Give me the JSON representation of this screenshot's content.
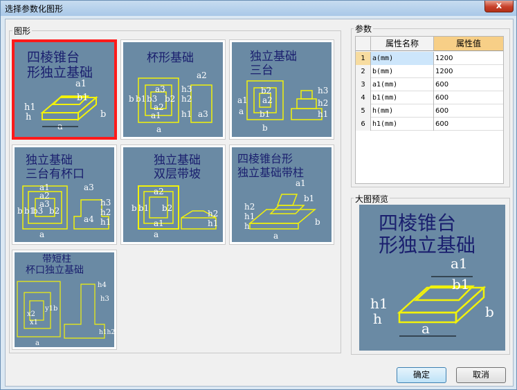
{
  "window": {
    "title": "选择参数化图形",
    "close_symbol": "x"
  },
  "shapes_group": {
    "label": "图形",
    "thumbnails": [
      {
        "lines": [
          "四棱锥台",
          "形独立基础"
        ],
        "dims": [
          "a1",
          "b1",
          "h1",
          "h",
          "a",
          "b"
        ]
      },
      {
        "lines": [
          "杯形基础"
        ],
        "dims": [
          "a2",
          "a3",
          "b",
          "b1",
          "b3",
          "b2",
          "a2",
          "a1",
          "h3",
          "h2",
          "h1",
          "a3",
          "a"
        ]
      },
      {
        "lines": [
          "独立基础",
          "三台"
        ],
        "dims": [
          "b2",
          "a1",
          "a2",
          "b1",
          "h3",
          "h2",
          "h1",
          "a",
          "b"
        ]
      },
      {
        "lines": [
          "独立基础",
          "三台有杯口"
        ],
        "dims": [
          "a1",
          "a2",
          "a3",
          "b3",
          "b2",
          "b1",
          "b",
          "a3",
          "h3",
          "h2",
          "h1",
          "a4",
          "a"
        ]
      },
      {
        "lines": [
          "独立基础",
          "双层带坡"
        ],
        "dims": [
          "a2",
          "b",
          "b1",
          "b2",
          "a1",
          "a",
          "h2",
          "h1"
        ]
      },
      {
        "lines": [
          "四棱锥台形",
          "独立基础带柱"
        ],
        "dims": [
          "a1",
          "b1",
          "h2",
          "h1",
          "h",
          "b",
          "a"
        ]
      },
      {
        "lines": [
          "带短柱",
          "杯口独立基础"
        ],
        "dims": [
          "h4",
          "h3",
          "x2",
          "x1",
          "y1",
          "b",
          "h1h2",
          "a"
        ]
      }
    ]
  },
  "params_group": {
    "label": "参数",
    "headers": [
      "属性名称",
      "属性值"
    ],
    "rows": [
      {
        "index": "1",
        "name": "a(mm)",
        "value": "1200"
      },
      {
        "index": "2",
        "name": "b(mm)",
        "value": "1200"
      },
      {
        "index": "3",
        "name": "a1(mm)",
        "value": "600"
      },
      {
        "index": "4",
        "name": "b1(mm)",
        "value": "600"
      },
      {
        "index": "5",
        "name": "h(mm)",
        "value": "600"
      },
      {
        "index": "6",
        "name": "h1(mm)",
        "value": "600"
      }
    ]
  },
  "preview_group": {
    "label": "大图预览",
    "lines": [
      "四棱锥台",
      "形独立基础"
    ],
    "dims": [
      "a1",
      "b1",
      "h1",
      "h",
      "a",
      "b"
    ]
  },
  "buttons": {
    "ok": "确定",
    "cancel": "取消"
  },
  "colors": {
    "thumb_bg": "#6a8aa4",
    "line": "#f2f20a",
    "title_text": "#1a1f6e",
    "dim_text": "#ffffff",
    "selected_border": "#ff1a1a",
    "header_highlight": "#f7cf87",
    "row_selected": "#cde6fb"
  }
}
